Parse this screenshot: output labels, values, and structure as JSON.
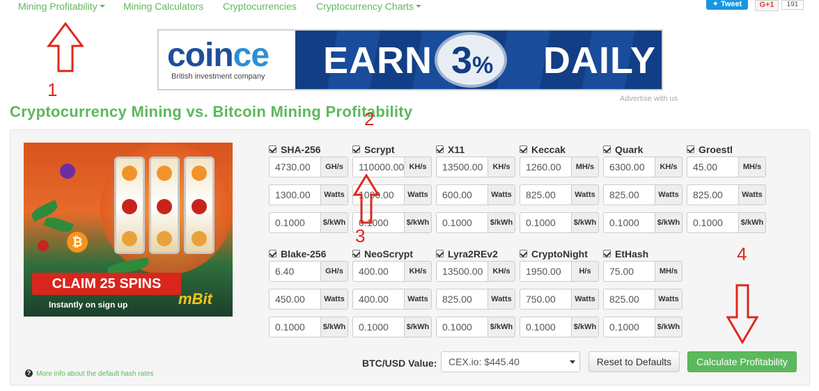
{
  "nav": {
    "items": [
      {
        "label": "Mining Profitability",
        "dropdown": true
      },
      {
        "label": "Mining Calculators",
        "dropdown": false
      },
      {
        "label": "Cryptocurrencies",
        "dropdown": false
      },
      {
        "label": "Cryptocurrency Charts",
        "dropdown": true
      }
    ],
    "tweet_label": "Tweet",
    "gplus_label": "G+1",
    "gplus_count": "191"
  },
  "banner": {
    "logo_co": "coin",
    "logo_ce": "ce",
    "subtitle": "British investment company",
    "earn": "EARN",
    "percent": "3",
    "percent_sign": "%",
    "daily": "DAILY"
  },
  "advertise_label": "Advertise with us",
  "page_title": "Cryptocurrency Mining vs. Bitcoin Mining Profitability",
  "annotations": [
    "1",
    "2",
    "3",
    "4"
  ],
  "ad": {
    "claim": "CLAIM 25 SPINS",
    "instant": "Instantly on sign up",
    "brand": "mBit"
  },
  "algorithms": [
    {
      "name": "SHA-256",
      "hashrate": "4730.00",
      "hash_unit": "GH/s",
      "power": "1300.00",
      "power_unit": "Watts",
      "cost": "0.1000",
      "cost_unit": "$/kWh"
    },
    {
      "name": "Scrypt",
      "hashrate": "110000.00",
      "hash_unit": "KH/s",
      "power": "1000.00",
      "power_unit": "Watts",
      "cost": "0.1000",
      "cost_unit": "$/kWh"
    },
    {
      "name": "X11",
      "hashrate": "13500.00",
      "hash_unit": "KH/s",
      "power": "600.00",
      "power_unit": "Watts",
      "cost": "0.1000",
      "cost_unit": "$/kWh"
    },
    {
      "name": "Keccak",
      "hashrate": "1260.00",
      "hash_unit": "MH/s",
      "power": "825.00",
      "power_unit": "Watts",
      "cost": "0.1000",
      "cost_unit": "$/kWh"
    },
    {
      "name": "Quark",
      "hashrate": "6300.00",
      "hash_unit": "KH/s",
      "power": "825.00",
      "power_unit": "Watts",
      "cost": "0.1000",
      "cost_unit": "$/kWh"
    },
    {
      "name": "Groestl",
      "hashrate": "45.00",
      "hash_unit": "MH/s",
      "power": "825.00",
      "power_unit": "Watts",
      "cost": "0.1000",
      "cost_unit": "$/kWh"
    },
    {
      "name": "Blake-256",
      "hashrate": "6.40",
      "hash_unit": "GH/s",
      "power": "450.00",
      "power_unit": "Watts",
      "cost": "0.1000",
      "cost_unit": "$/kWh"
    },
    {
      "name": "NeoScrypt",
      "hashrate": "400.00",
      "hash_unit": "KH/s",
      "power": "400.00",
      "power_unit": "Watts",
      "cost": "0.1000",
      "cost_unit": "$/kWh"
    },
    {
      "name": "Lyra2REv2",
      "hashrate": "13500.00",
      "hash_unit": "KH/s",
      "power": "825.00",
      "power_unit": "Watts",
      "cost": "0.1000",
      "cost_unit": "$/kWh"
    },
    {
      "name": "CryptoNight",
      "hashrate": "1950.00",
      "hash_unit": "H/s",
      "power": "750.00",
      "power_unit": "Watts",
      "cost": "0.1000",
      "cost_unit": "$/kWh"
    },
    {
      "name": "EtHash",
      "hashrate": "75.00",
      "hash_unit": "MH/s",
      "power": "825.00",
      "power_unit": "Watts",
      "cost": "0.1000",
      "cost_unit": "$/kWh"
    }
  ],
  "controls": {
    "btc_label": "BTC/USD Value:",
    "btc_selected": "CEX.io: $445.40",
    "reset_label": "Reset to Defaults",
    "calculate_label": "Calculate Profitability"
  },
  "info_link": "More info about the default hash rates",
  "colors": {
    "accent_green": "#5cb85c",
    "annotation_red": "#e0271b",
    "banner_blue": "#123e86"
  }
}
